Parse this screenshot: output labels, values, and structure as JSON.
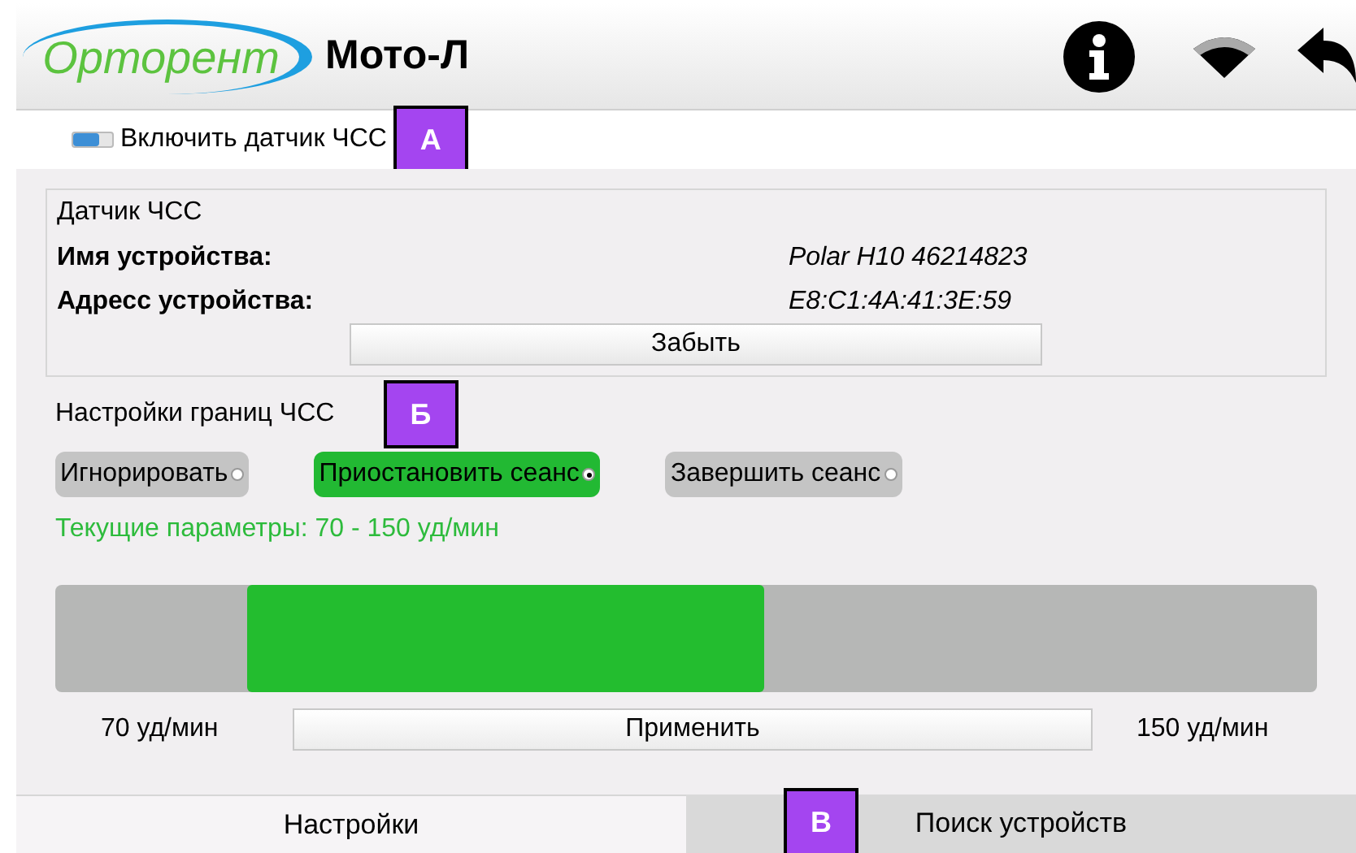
{
  "header": {
    "logo": "Орторент",
    "title": "Мото-Л"
  },
  "hr_toggle": {
    "label": "Включить датчик ЧСС",
    "on": true
  },
  "sensor": {
    "title": "Датчик ЧСС",
    "fields": [
      {
        "label": "Имя устройства:",
        "value": "Polar H10 46214823"
      },
      {
        "label": "Адресс устройства:",
        "value": "E8:C1:4A:41:3E:59"
      }
    ],
    "forget_button": "Забыть"
  },
  "limits": {
    "title": "Настройки границ ЧСС",
    "options": [
      {
        "label": "Игнорировать",
        "selected": false
      },
      {
        "label": "Приостановить сеанс",
        "selected": true
      },
      {
        "label": "Завершить сеанс",
        "selected": false
      }
    ],
    "current": "Текущие параметры: 70 - 150 уд/мин",
    "range": {
      "level": 0.41
    },
    "min_label": "70 уд/мин",
    "apply_button": "Применить",
    "max_label": "150 уд/мин"
  },
  "tabs": [
    {
      "label": "Настройки",
      "selected": true
    },
    {
      "label": "Поиск устройств",
      "selected": false
    }
  ],
  "markers": [
    "А",
    "Б",
    "В"
  ]
}
